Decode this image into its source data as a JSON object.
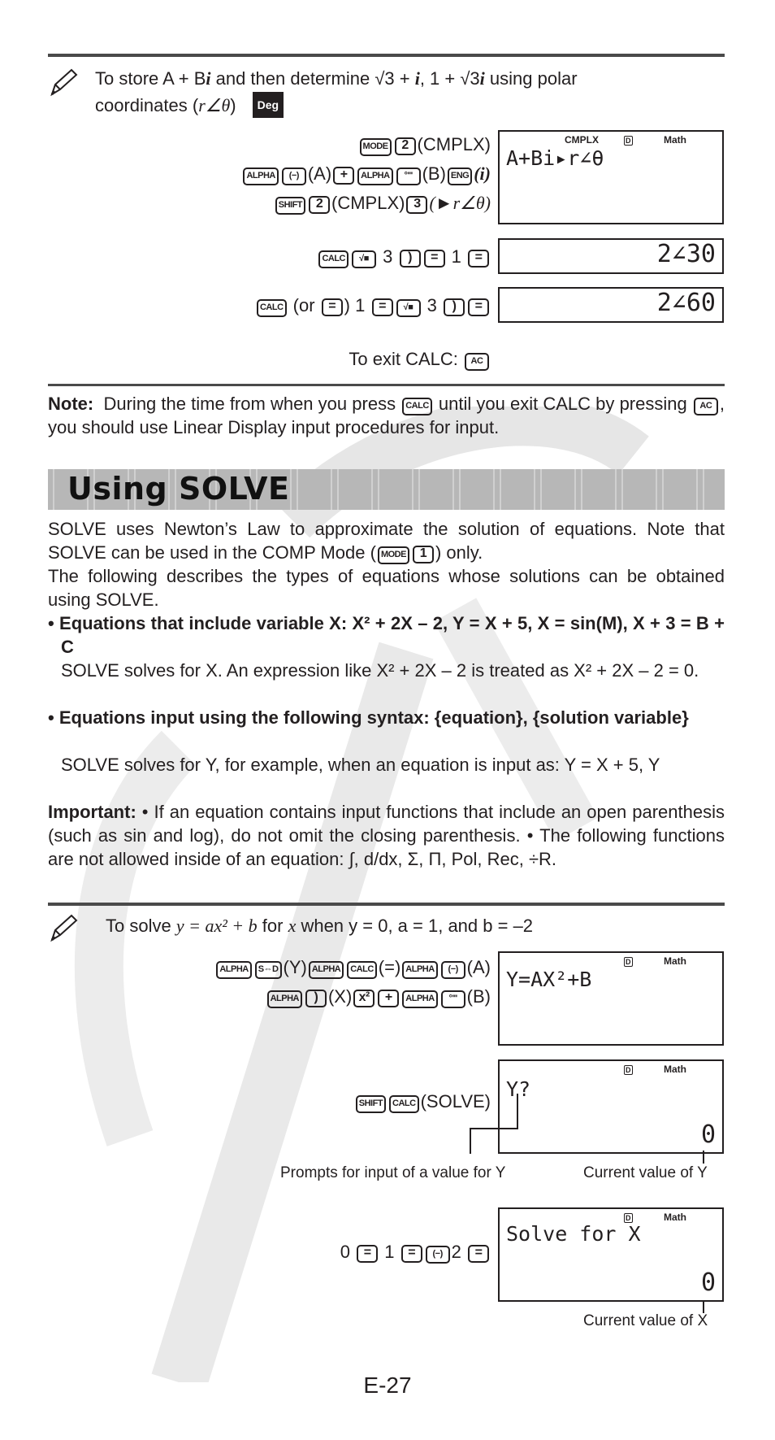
{
  "example1": {
    "intro_part1": "To store A + B",
    "intro_i": "i",
    "intro_part2": " and then determine ",
    "intro_expr1": "√3  + ",
    "intro_i2": "i",
    "intro_part3": ", 1 + √3",
    "intro_i3": "i",
    "intro_part4": " using polar",
    "intro_line2": "coordinates (",
    "intro_polar": "r∠θ",
    "intro_close": ")",
    "badge": "Deg",
    "steps": [
      {
        "keys": [
          "MODE",
          "2"
        ],
        "text": "(CMPLX)"
      },
      {
        "keys": [
          "ALPHA",
          "(−)",
          "+",
          "ALPHA",
          "°'''",
          "ENG"
        ],
        "text_parts": [
          "(A)",
          "(B)",
          "(i)"
        ]
      },
      {
        "keys": [
          "SHIFT",
          "2",
          "3"
        ],
        "text_parts": [
          "(CMPLX)",
          "(►r∠θ)"
        ]
      }
    ],
    "display1": {
      "indicators": [
        "CMPLX",
        "D",
        "Math"
      ],
      "expression": "A+Bi▸r∠θ"
    },
    "calc1": {
      "keys": [
        "CALC",
        "√■",
        "3",
        ")",
        "=",
        "1",
        "="
      ],
      "result": "2∠30"
    },
    "calc2": {
      "keys": [
        "CALC",
        "(or",
        "=",
        ")",
        "1",
        "=",
        "√■",
        "3",
        ")",
        "="
      ],
      "result": "2∠60"
    },
    "exit_label": "To exit CALC:",
    "exit_key": "AC"
  },
  "note": {
    "label": "Note:",
    "text1": "During the time from when you press",
    "key1": "CALC",
    "text2": "until you exit CALC by",
    "text3": "pressing",
    "key2": "AC",
    "text4": ", you should use Linear Display input procedures for input."
  },
  "section": {
    "title": "Using SOLVE",
    "p1a": "SOLVE uses Newton’s Law to approximate the solution of equations. Note",
    "p1b": "that SOLVE can be used in the COMP Mode (",
    "p1_keys": [
      "MODE",
      "1"
    ],
    "p1c": ") only.",
    "p2": "The following describes the types of equations whose solutions can be obtained using SOLVE.",
    "bullets": [
      {
        "head": "• Equations that include variable X: X² + 2X – 2, Y = X + 5, X = sin(M), X + 3 = B + C",
        "body": "SOLVE solves for X. An expression like X² + 2X – 2 is treated as X² + 2X – 2 = 0."
      },
      {
        "head": "• Equations input using the following syntax: {equation}, {solution variable}",
        "body": "SOLVE solves for Y, for example, when an equation is input as: Y = X + 5, Y"
      }
    ],
    "important_label": "Important:",
    "important_text1": " • If an equation contains input functions that include an open parenthesis (such as sin and log), do not omit the closing parenthesis.",
    "important_text2": "• The following functions are not allowed inside of an equation: ∫, d/dx, Σ, Π, Pol, Rec, ÷R."
  },
  "example2": {
    "intro_prefix": "To solve ",
    "intro_eq": "y = ax² + b",
    "intro_for": " for ",
    "intro_x": "x",
    "intro_rest": " when y = 0, a = 1, and b = –2",
    "step1_line1": {
      "keys": [
        "ALPHA",
        "S⇔D",
        "ALPHA",
        "CALC",
        "ALPHA",
        "(−)"
      ],
      "labels": [
        "(Y)",
        "(=)",
        "(A)"
      ]
    },
    "step1_line2": {
      "keys": [
        "ALPHA",
        ")",
        "x²",
        "+",
        "ALPHA",
        "°'''"
      ],
      "labels": [
        "(X)",
        "(B)"
      ]
    },
    "display1": {
      "indicators": [
        "D",
        "Math"
      ],
      "expression": "Y=AX²+B"
    },
    "step2": {
      "keys": [
        "SHIFT",
        "CALC"
      ],
      "label": "(SOLVE)"
    },
    "display2": {
      "indicators": [
        "D",
        "Math"
      ],
      "expression": "Y?",
      "result": "0"
    },
    "callout_prompt": "Prompts for input of a value for Y",
    "callout_current_y": "Current value of Y",
    "step3": {
      "keys": [
        "0",
        "=",
        "1",
        "=",
        "(−)",
        "2",
        "="
      ]
    },
    "display3": {
      "indicators": [
        "D",
        "Math"
      ],
      "expression": "Solve for X",
      "result": "0"
    },
    "callout_current_x": "Current value of X"
  },
  "page_number": "E-27"
}
